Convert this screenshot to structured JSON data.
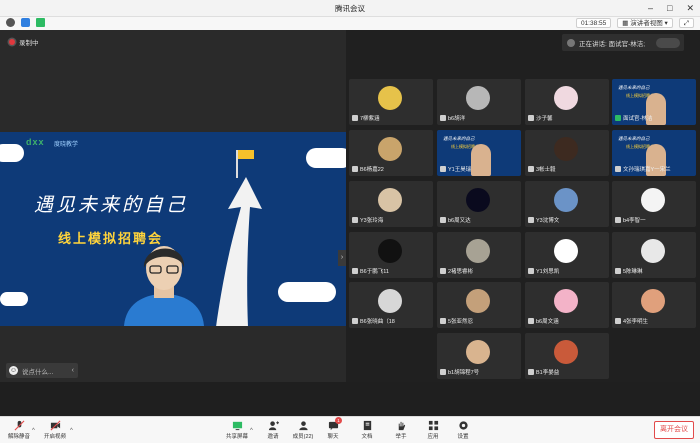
{
  "window": {
    "title": "腾讯会议"
  },
  "topbar": {
    "timer": "01:38:55",
    "speaker_view_label": "演讲者视图",
    "fullscreen_icon": "expand-icon"
  },
  "stage": {
    "recording_label": "录制中",
    "share": {
      "logo_text": "dxx",
      "logo_sub": "度晓教学",
      "headline": "遇见未来的自己",
      "subline": "线上模拟招聘会"
    },
    "comment_placeholder": "说点什么..."
  },
  "speaking": {
    "label": "正在讲话: 面试官-林洁;"
  },
  "tiles": [
    {
      "name": "7柳紫涵",
      "avatar": "#e6c24a"
    },
    {
      "name": "b6胡洋",
      "avatar": "#b7b7b7"
    },
    {
      "name": "沙子馨",
      "avatar": "#f0d9e0"
    },
    {
      "name": "面试官-林洁",
      "screen": true,
      "mic_on": true
    },
    {
      "name": "B6杨嘉22",
      "avatar": "#c9a46b"
    },
    {
      "name": "Y1王昊瑞",
      "screen": true,
      "mic_on": false
    },
    {
      "name": "3帐士毅",
      "avatar": "#3d2a20"
    },
    {
      "name": "文孙瑞琪嘉Y一宋兰",
      "screen": true,
      "mic_on": false
    },
    {
      "name": "Y3张玲海",
      "avatar": "#d8c3a5"
    },
    {
      "name": "b6周又达",
      "avatar": "#0a0a1e"
    },
    {
      "name": "Y3沈博文",
      "avatar": "#6b93c7"
    },
    {
      "name": "b4李智一",
      "avatar": "#f4f4f4"
    },
    {
      "name": "B6于鹏飞11",
      "avatar": "#111111"
    },
    {
      "name": "2褚思睿彬",
      "avatar": "#a7a294"
    },
    {
      "name": "Y1刘思凯",
      "avatar": "#ffffff"
    },
    {
      "name": "5陈琳琳",
      "avatar": "#e8e8e8"
    },
    {
      "name": "B6张晓曲（18",
      "avatar": "#d7d7d7"
    },
    {
      "name": "5张亚然忍",
      "avatar": "#c4a07a"
    },
    {
      "name": "b6周文涵",
      "avatar": "#f3b3c8"
    },
    {
      "name": "4张李明生",
      "avatar": "#e0a07c"
    },
    {
      "name": "b1胡锦程7号",
      "avatar": "#d9b48f"
    },
    {
      "name": "B1李晏益",
      "avatar": "#c95a3a"
    }
  ],
  "toolbar": {
    "mic_label": "解除静音",
    "video_label": "开启视频",
    "share_label": "共享屏幕",
    "invite_label": "邀请",
    "members_label": "成员(22)",
    "chat_label": "聊天",
    "chat_badge": "1",
    "docs_label": "文档",
    "raise_label": "举手",
    "apps_label": "应用",
    "settings_label": "设置",
    "leave_label": "离开会议"
  }
}
